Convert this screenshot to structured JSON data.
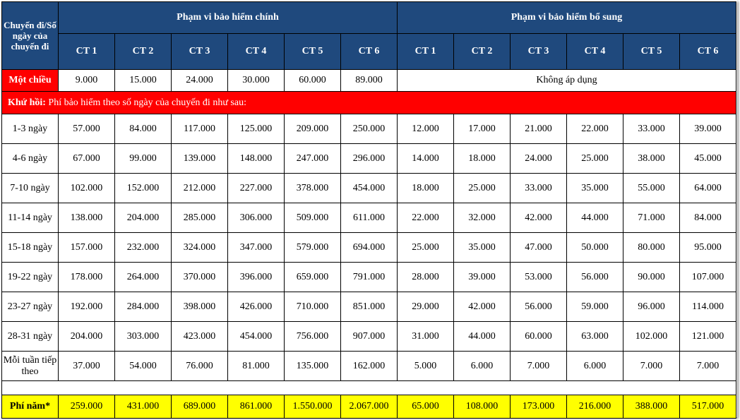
{
  "header": {
    "corner_label": "Chuyến đi/Số ngày của chuyến đi",
    "main_group": "Phạm vi bảo hiểm chính",
    "extra_group": "Phạm vi bảo hiểm bổ sung",
    "plans": [
      "CT 1",
      "CT 2",
      "CT 3",
      "CT 4",
      "CT 5",
      "CT 6"
    ]
  },
  "one_way": {
    "label": "Một chiều",
    "main": [
      "9.000",
      "15.000",
      "24.000",
      "30.000",
      "60.000",
      "89.000"
    ],
    "extra_note": "Không áp dụng"
  },
  "round_trip": {
    "label": "Khứ hồi:",
    "note": "Phí bảo hiểm theo số ngày của chuyến đi như sau:"
  },
  "rows": [
    {
      "label": "1-3 ngày",
      "main": [
        "57.000",
        "84.000",
        "117.000",
        "125.000",
        "209.000",
        "250.000"
      ],
      "extra": [
        "12.000",
        "17.000",
        "21.000",
        "22.000",
        "33.000",
        "39.000"
      ]
    },
    {
      "label": "4-6 ngày",
      "main": [
        "67.000",
        "99.000",
        "139.000",
        "148.000",
        "247.000",
        "296.000"
      ],
      "extra": [
        "14.000",
        "18.000",
        "24.000",
        "25.000",
        "38.000",
        "45.000"
      ]
    },
    {
      "label": "7-10 ngày",
      "main": [
        "102.000",
        "152.000",
        "212.000",
        "227.000",
        "378.000",
        "454.000"
      ],
      "extra": [
        "18.000",
        "25.000",
        "33.000",
        "35.000",
        "55.000",
        "64.000"
      ]
    },
    {
      "label": "11-14 ngày",
      "main": [
        "138.000",
        "204.000",
        "285.000",
        "306.000",
        "509.000",
        "611.000"
      ],
      "extra": [
        "22.000",
        "32.000",
        "42.000",
        "44.000",
        "71.000",
        "84.000"
      ]
    },
    {
      "label": "15-18 ngày",
      "main": [
        "157.000",
        "232.000",
        "324.000",
        "347.000",
        "579.000",
        "694.000"
      ],
      "extra": [
        "25.000",
        "35.000",
        "47.000",
        "50.000",
        "80.000",
        "95.000"
      ]
    },
    {
      "label": "19-22 ngày",
      "main": [
        "178.000",
        "264.000",
        "370.000",
        "396.000",
        "659.000",
        "791.000"
      ],
      "extra": [
        "28.000",
        "39.000",
        "53.000",
        "56.000",
        "90.000",
        "107.000"
      ]
    },
    {
      "label": "23-27 ngày",
      "main": [
        "192.000",
        "284.000",
        "398.000",
        "426.000",
        "710.000",
        "851.000"
      ],
      "extra": [
        "29.000",
        "42.000",
        "56.000",
        "59.000",
        "96.000",
        "114.000"
      ]
    },
    {
      "label": "28-31 ngày",
      "main": [
        "204.000",
        "303.000",
        "423.000",
        "454.000",
        "756.000",
        "907.000"
      ],
      "extra": [
        "31.000",
        "44.000",
        "60.000",
        "63.000",
        "102.000",
        "121.000"
      ]
    },
    {
      "label": "Mỗi tuần tiếp theo",
      "main": [
        "37.000",
        "54.000",
        "76.000",
        "81.000",
        "135.000",
        "162.000"
      ],
      "extra": [
        "5.000",
        "6.000",
        "7.000",
        "6.000",
        "7.000",
        "7.000"
      ]
    }
  ],
  "annual": {
    "label": "Phí năm*",
    "main": [
      "259.000",
      "431.000",
      "689.000",
      "861.000",
      "1.550.000",
      "2.067.000"
    ],
    "extra": [
      "65.000",
      "108.000",
      "173.000",
      "216.000",
      "388.000",
      "517.000"
    ]
  },
  "colors": {
    "header_bg": "#1f497d",
    "highlight_red": "#ff0000",
    "highlight_yellow": "#ffff00"
  }
}
